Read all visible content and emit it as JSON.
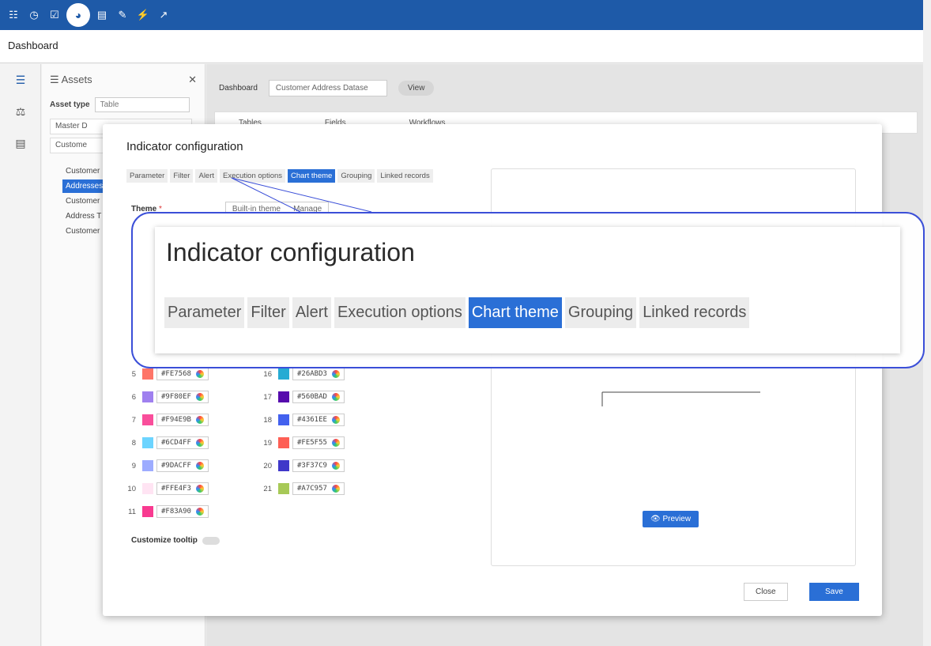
{
  "app": {
    "page_title": "Dashboard"
  },
  "topbar": {
    "icons": [
      "database-icon",
      "clock-icon",
      "checklist-icon",
      "dashboard-gauge-icon",
      "document-icon",
      "edit-check-icon",
      "plug-icon",
      "wrench-icon"
    ]
  },
  "assets_panel": {
    "title": "Assets",
    "asset_type_label": "Asset type",
    "asset_type_value": "Table",
    "field1": "Master D",
    "field2": "Custome",
    "items": [
      "Customer",
      "Addresses",
      "Customer",
      "Address T",
      "Customer"
    ],
    "selected_index": 1
  },
  "main": {
    "breadcrumb_label": "Dashboard",
    "dataset_select": "Customer Address Datase",
    "view_button": "View",
    "tabs": [
      "Tables",
      "Fields",
      "Workflows"
    ]
  },
  "modal": {
    "title": "Indicator configuration",
    "tabs": [
      "Parameter",
      "Filter",
      "Alert",
      "Execution options",
      "Chart theme",
      "Grouping",
      "Linked records"
    ],
    "active_tab": "Chart theme",
    "theme_label": "Theme",
    "theme_required_mark": "*",
    "theme_option_1": "Built-in theme",
    "theme_option_2": "Manage",
    "colors_left": [
      {
        "n": "5",
        "hex": "#FE7568"
      },
      {
        "n": "6",
        "hex": "#9F80EF"
      },
      {
        "n": "7",
        "hex": "#F94E9B"
      },
      {
        "n": "8",
        "hex": "#6CD4FF"
      },
      {
        "n": "9",
        "hex": "#9DACFF"
      },
      {
        "n": "10",
        "hex": "#FFE4F3"
      },
      {
        "n": "11",
        "hex": "#F83A90"
      }
    ],
    "colors_right": [
      {
        "n": "16",
        "hex": "#26ABD3"
      },
      {
        "n": "17",
        "hex": "#560BAD"
      },
      {
        "n": "18",
        "hex": "#4361EE"
      },
      {
        "n": "19",
        "hex": "#FE5F55"
      },
      {
        "n": "20",
        "hex": "#3F37C9"
      },
      {
        "n": "21",
        "hex": "#A7C957"
      }
    ],
    "customize_tooltip_label": "Customize tooltip",
    "preview_button": "Preview",
    "close_button": "Close",
    "save_button": "Save"
  },
  "zoom_callout": {
    "title": "Indicator configuration",
    "tabs": [
      "Parameter",
      "Filter",
      "Alert",
      "Execution options",
      "Chart theme",
      "Grouping",
      "Linked records"
    ],
    "active_tab": "Chart theme"
  },
  "colors": {
    "topbar": "#1e5aa8",
    "accent": "#2a6fd6",
    "callout_border": "#3b4fd8"
  }
}
